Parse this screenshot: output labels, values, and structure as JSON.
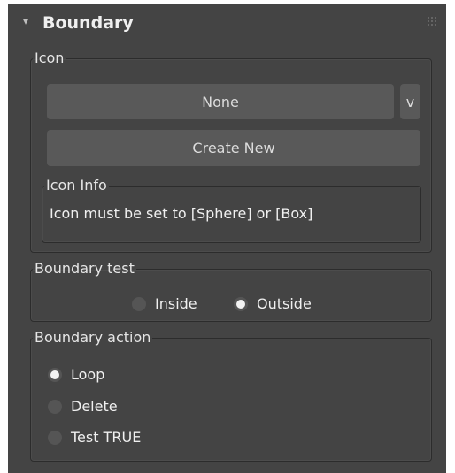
{
  "rollout": {
    "title": "Boundary",
    "collapse_glyph": "▾"
  },
  "icon_group": {
    "legend": "Icon",
    "current_icon": "None",
    "dropdown_label": "v",
    "create_new_label": "Create New",
    "info": {
      "legend": "Icon Info",
      "text": "Icon must be set to [Sphere] or [Box]"
    }
  },
  "boundary_test": {
    "legend": "Boundary test",
    "options": [
      {
        "label": "Inside",
        "selected": false
      },
      {
        "label": "Outside",
        "selected": true
      }
    ]
  },
  "boundary_action": {
    "legend": "Boundary action",
    "options": [
      {
        "label": "Loop",
        "selected": true
      },
      {
        "label": "Delete",
        "selected": false
      },
      {
        "label": "Test TRUE",
        "selected": false
      }
    ]
  },
  "colors": {
    "panel_bg": "#444444",
    "button_bg": "#595959",
    "border": "#2c2c2c"
  }
}
